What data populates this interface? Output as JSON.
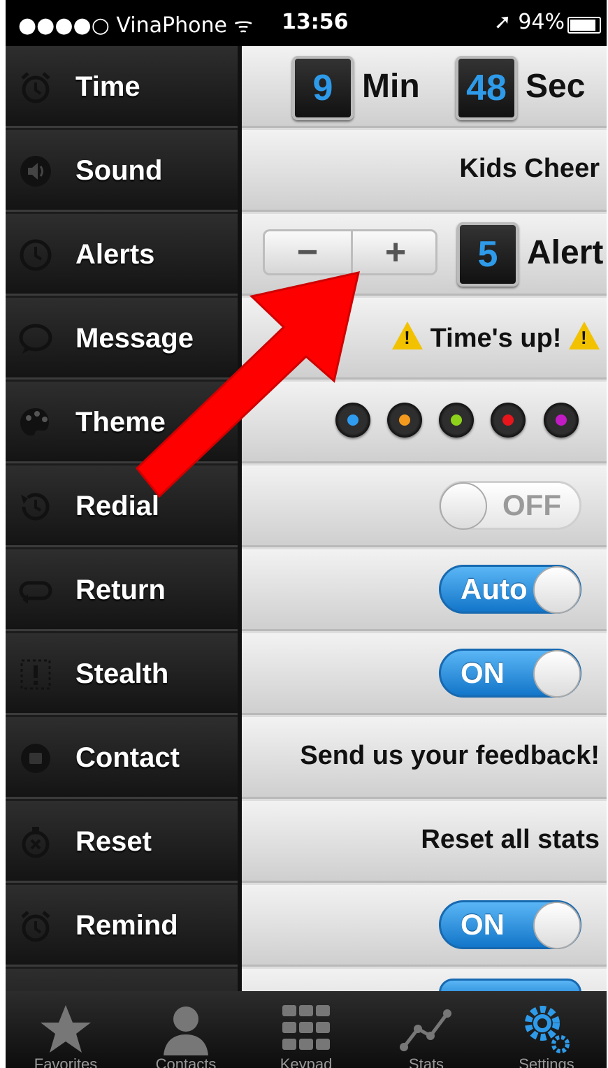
{
  "status_bar": {
    "carrier": "●●●●○ VinaPhone ᯤ",
    "time": "13:56",
    "right": "➚ 94%"
  },
  "sidebar": {
    "items": [
      {
        "label": "Time",
        "icon": "alarm-clock-icon"
      },
      {
        "label": "Sound",
        "icon": "speaker-icon"
      },
      {
        "label": "Alerts",
        "icon": "clock-icon"
      },
      {
        "label": "Message",
        "icon": "speech-bubble-icon"
      },
      {
        "label": "Theme",
        "icon": "palette-icon"
      },
      {
        "label": "Redial",
        "icon": "history-icon"
      },
      {
        "label": "Return",
        "icon": "return-icon"
      },
      {
        "label": "Stealth",
        "icon": "stealth-icon"
      },
      {
        "label": "Contact",
        "icon": "contact-icon"
      },
      {
        "label": "Reset",
        "icon": "reset-timer-icon"
      },
      {
        "label": "Remind",
        "icon": "alarm-clock-icon"
      }
    ]
  },
  "settings": {
    "time": {
      "minutes": "9",
      "min_label": "Min",
      "seconds": "48",
      "sec_label": "Sec"
    },
    "sound": "Kids Cheer",
    "alerts": {
      "minus": "−",
      "plus": "+",
      "count": "5",
      "label": "Alert"
    },
    "message": "Time's up!",
    "theme_colors": [
      "#2f9cf0",
      "#f39a1e",
      "#8ed31b",
      "#e8151c",
      "#c21bc4"
    ],
    "redial": "OFF",
    "return": "Auto",
    "stealth": "ON",
    "contact": "Send us your feedback!",
    "reset": "Reset all stats",
    "remind": "ON"
  },
  "tab_bar": {
    "tabs": [
      {
        "label": "Favorites",
        "icon": "star-icon"
      },
      {
        "label": "Contacts",
        "icon": "person-icon"
      },
      {
        "label": "Keypad",
        "icon": "keypad-icon"
      },
      {
        "label": "Stats",
        "icon": "chart-icon"
      },
      {
        "label": "Settings",
        "icon": "gear-icon"
      }
    ],
    "selected": "Settings"
  },
  "colors": {
    "accent_blue": "#2e9bea",
    "arrow_red": "#ff0000"
  }
}
